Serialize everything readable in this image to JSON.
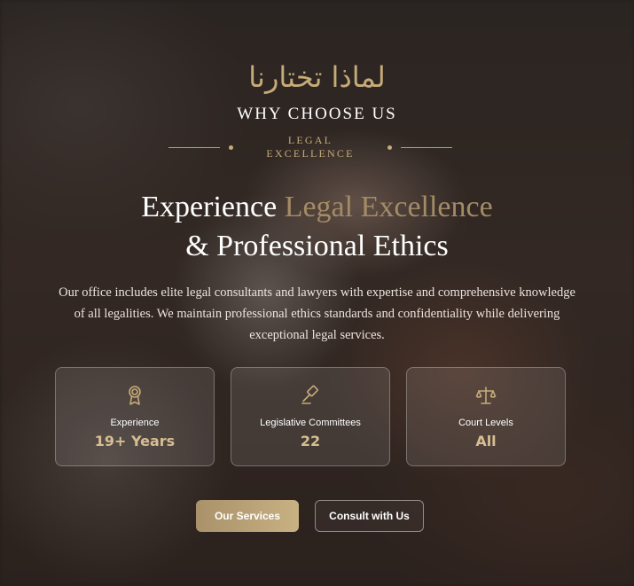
{
  "hero": {
    "arabic_title": "لماذا تختارنا",
    "kicker": "WHY CHOOSE US",
    "tagline": "LEGAL EXCELLENCE",
    "headline_part1": "Experience",
    "headline_highlight": "Legal Excellence",
    "headline_part2": "& Professional Ethics",
    "description": "Our office includes elite legal consultants and lawyers with expertise and comprehensive knowledge of all legalities. We maintain professional ethics standards and confidentiality while delivering exceptional legal services."
  },
  "stats": [
    {
      "icon": "award-icon",
      "label": "Experience",
      "value": "19+ Years"
    },
    {
      "icon": "gavel-icon",
      "label": "Legislative Committees",
      "value": "22"
    },
    {
      "icon": "scales-icon",
      "label": "Court Levels",
      "value": "All"
    }
  ],
  "buttons": {
    "primary": "Our Services",
    "secondary": "Consult with Us"
  },
  "colors": {
    "gold": "#c6ab78",
    "gold_muted": "#a38b66",
    "button_gradient_start": "#a9916a",
    "button_gradient_end": "#c8b182"
  }
}
